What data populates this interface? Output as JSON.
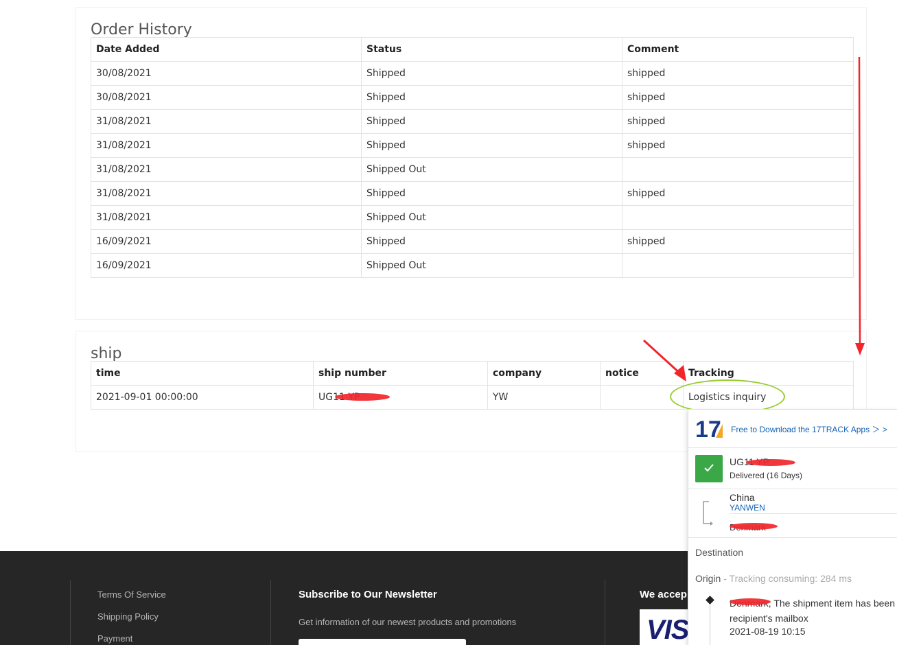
{
  "order_history": {
    "title": "Order History",
    "columns": [
      "Date Added",
      "Status",
      "Comment"
    ],
    "rows": [
      [
        "30/08/2021",
        "Shipped",
        "shipped"
      ],
      [
        "30/08/2021",
        "Shipped",
        "shipped"
      ],
      [
        "31/08/2021",
        "Shipped",
        "shipped"
      ],
      [
        "31/08/2021",
        "Shipped",
        "shipped"
      ],
      [
        "31/08/2021",
        "Shipped Out",
        ""
      ],
      [
        "31/08/2021",
        "Shipped",
        "shipped"
      ],
      [
        "31/08/2021",
        "Shipped Out",
        ""
      ],
      [
        "16/09/2021",
        "Shipped",
        "shipped"
      ],
      [
        "16/09/2021",
        "Shipped Out",
        ""
      ]
    ]
  },
  "ship": {
    "title": "ship",
    "columns": [
      "time",
      "ship number",
      "company",
      "notice",
      "Tracking"
    ],
    "row": {
      "time": "2021-09-01 00:00:00",
      "ship_number": "UG11       YP",
      "company": "YW",
      "notice": "",
      "tracking_link": "Logistics inquiry"
    }
  },
  "tracking_popup": {
    "logo_text": "17",
    "download_link": "Free to Download the 17TRACK Apps ＞ >",
    "tracking_number": "UG11          YP",
    "status": "Delivered (16 Days)",
    "origin_country": "China",
    "carrier": "YANWEN",
    "destination_country": "Denmark",
    "destination_label": "Destination",
    "origin_label": "Origin",
    "origin_sub": " - Tracking consuming: 284 ms",
    "event_text": "Denmark, The shipment item has been recipient's mailbox",
    "event_time": "2021-08-19 10:15",
    "check_icon": "check-icon",
    "accent_green": "#3aa846",
    "link_blue": "#1463b5"
  },
  "footer": {
    "links": [
      "Terms Of Service",
      "Shipping Policy",
      "Payment"
    ],
    "newsletter_heading": "Subscribe to Our Newsletter",
    "newsletter_text": "Get information of our newest products and promotions",
    "accept_heading": "We accep",
    "visa_text": "VIS",
    "background": "#262626"
  },
  "annotations": {
    "arrow_color": "#f0262b",
    "ellipse_color": "#9acd32"
  }
}
